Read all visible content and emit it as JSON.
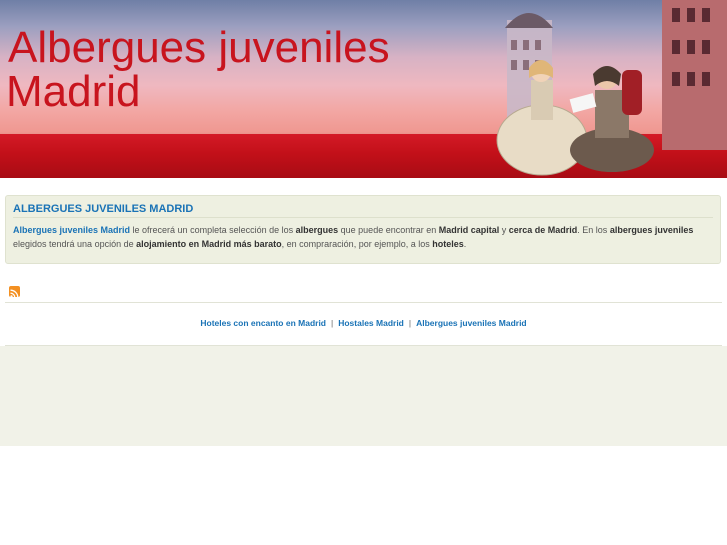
{
  "header": {
    "title_line1": "Albergues juveniles",
    "title_line2": "Madrid",
    "illustration_icon": "madrid-meninas-illustration"
  },
  "infobox": {
    "heading": "ALBERGUES JUVENILES MADRID",
    "text": {
      "s1": "Albergues juveniles Madrid",
      "s2": " le ofrecerá un completa selección de los ",
      "s3": "albergues",
      "s4": " que puede encontrar en ",
      "s5": "Madrid capital",
      "s6": " y ",
      "s7": "cerca de Madrid",
      "s8": ". En los ",
      "s9": "albergues juveniles",
      "s10": " elegidos tendrá una opción de ",
      "s11": "alojamiento en Madrid más barato",
      "s12": ", en compraración, por ejemplo, a los ",
      "s13": "hoteles",
      "s14": "."
    }
  },
  "rss": {
    "icon": "rss-icon"
  },
  "footer": {
    "links": [
      "Hoteles con encanto en Madrid",
      "Hostales Madrid",
      "Albergues juveniles Madrid"
    ],
    "separator": "|"
  },
  "colors": {
    "title_red": "#c8141e",
    "link_blue": "#1a73b6",
    "box_bg": "#eef0e1",
    "rss_orange": "#f39022"
  }
}
